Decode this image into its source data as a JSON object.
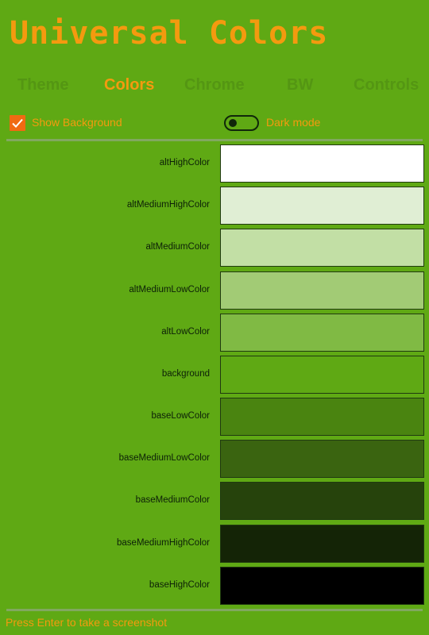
{
  "app": {
    "title": "Universal Colors"
  },
  "tabs": [
    {
      "label": "Theme"
    },
    {
      "label": "Colors",
      "active": true
    },
    {
      "label": "Chrome"
    },
    {
      "label": "BW"
    },
    {
      "label": "Controls"
    }
  ],
  "options": {
    "show_background": {
      "label": "Show Background",
      "checked": true
    },
    "dark_mode": {
      "label": "Dark mode",
      "on": false
    }
  },
  "swatches": [
    {
      "name": "altHighColor",
      "color": "#ffffff"
    },
    {
      "name": "altMediumHighColor",
      "color": "#e0eed4"
    },
    {
      "name": "altMediumColor",
      "color": "#c2dfa5"
    },
    {
      "name": "altMediumLowColor",
      "color": "#a2cb75"
    },
    {
      "name": "altLowColor",
      "color": "#80ba44"
    },
    {
      "name": "background",
      "color": "#5fa914"
    },
    {
      "name": "baseLowColor",
      "color": "#4a8410"
    },
    {
      "name": "baseMediumLowColor",
      "color": "#3a6410"
    },
    {
      "name": "baseMediumColor",
      "color": "#26430c"
    },
    {
      "name": "baseMediumHighColor",
      "color": "#142406"
    },
    {
      "name": "baseHighColor",
      "color": "#000000"
    }
  ],
  "footer": {
    "hint": "Press Enter to take a screenshot"
  },
  "colors": {
    "accent": "#f49a0f",
    "checkbox": "#f06a12",
    "tab_inactive": "#549613",
    "app_background": "#5fa914"
  }
}
